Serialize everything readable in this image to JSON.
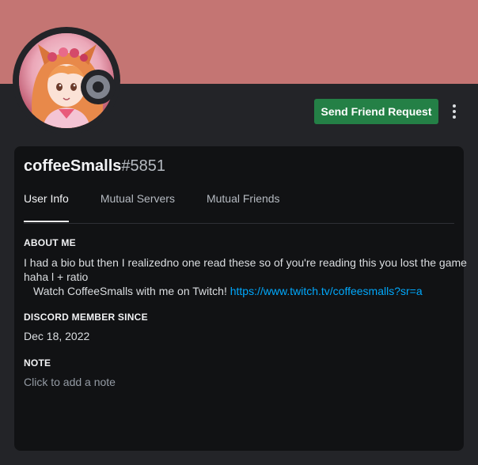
{
  "profile": {
    "username": "coffeeSmalls",
    "discriminator": "#5851",
    "status": "offline",
    "banner_color": "#c47573"
  },
  "actions": {
    "send_friend_request_label": "Send Friend Request",
    "more_icon": "more-vertical-icon"
  },
  "tabs": [
    {
      "label": "User Info",
      "active": true
    },
    {
      "label": "Mutual Servers",
      "active": false
    },
    {
      "label": "Mutual Friends",
      "active": false
    }
  ],
  "about": {
    "heading": "ABOUT ME",
    "line1": "I had a bio but then I realizedno one read these so of you're reading this you lost the game",
    "line2": "haha l + ratio",
    "line3_text": "Watch CoffeeSmalls with me on Twitch! ",
    "line3_link": "https://www.twitch.tv/coffeesmalls?sr=a"
  },
  "member_since": {
    "heading": "DISCORD MEMBER SINCE",
    "value": "Dec 18, 2022"
  },
  "note": {
    "heading": "NOTE",
    "placeholder": "Click to add a note"
  },
  "colors": {
    "accent_green": "#248046",
    "link": "#00a8fc",
    "background": "#232428",
    "card": "#111214"
  }
}
